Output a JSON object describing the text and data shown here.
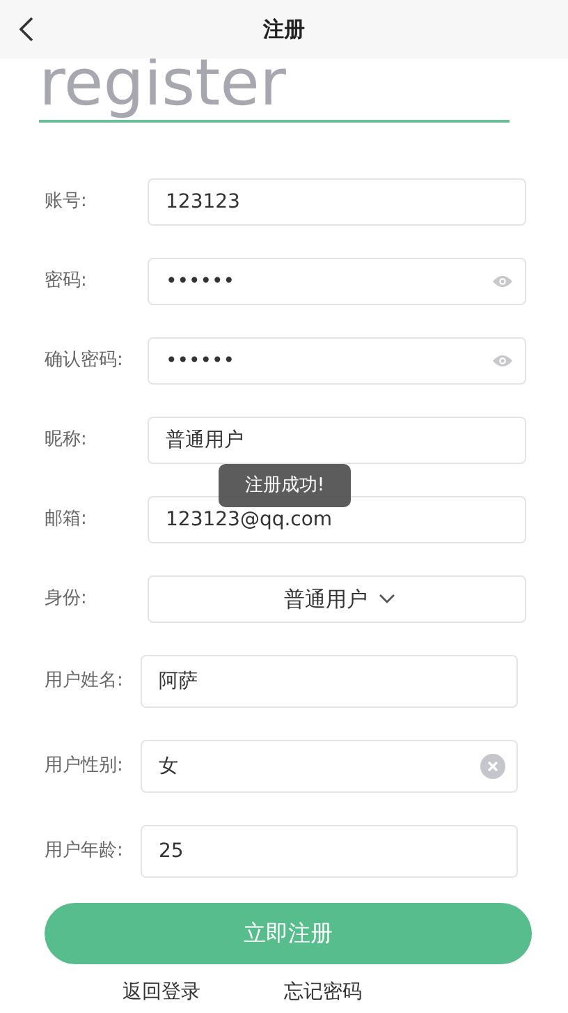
{
  "header": {
    "title": "注册"
  },
  "heading": "register",
  "fields": [
    {
      "label": "账号:",
      "kind": "text",
      "value": "123123"
    },
    {
      "label": "密码:",
      "kind": "password",
      "value": "••••••"
    },
    {
      "label": "确认密码:",
      "kind": "password",
      "value": "••••••"
    },
    {
      "label": "昵称:",
      "kind": "text",
      "value": "普通用户"
    },
    {
      "label": "邮箱:",
      "kind": "text",
      "value": "123123@qq.com"
    },
    {
      "label": "身份:",
      "kind": "select",
      "value": "普通用户"
    },
    {
      "label": "用户姓名:",
      "kind": "text",
      "value": "阿萨"
    },
    {
      "label": "用户性别:",
      "kind": "clearable",
      "value": "女"
    },
    {
      "label": "用户年龄:",
      "kind": "text",
      "value": "25"
    }
  ],
  "submit": "立即注册",
  "links": [
    "返回登录",
    "忘记密码"
  ],
  "toast": "注册成功!"
}
